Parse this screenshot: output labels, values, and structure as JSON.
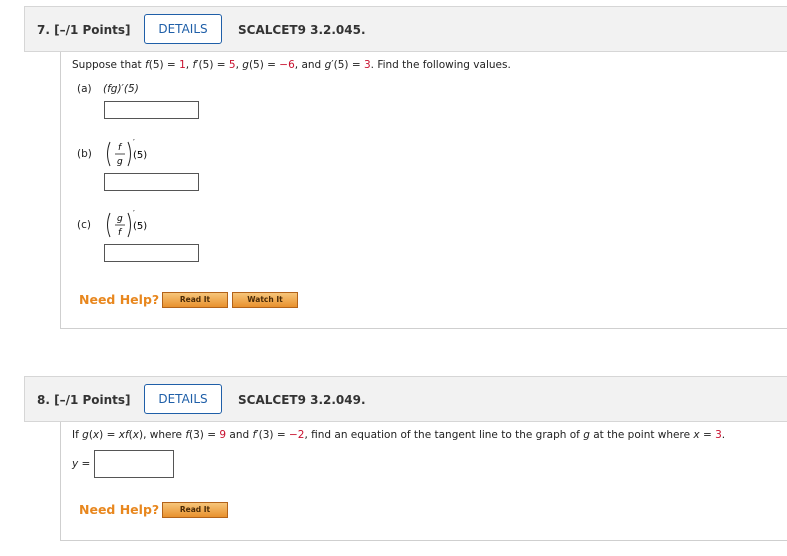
{
  "questions": [
    {
      "number": "7. [–/1 Points]",
      "details_label": "DETAILS",
      "code": "SCALCET9 3.2.045.",
      "prompt_parts": {
        "p1": "Suppose that ",
        "f": "f",
        "p2": "(5) = ",
        "v1": "1",
        "p3": ", ",
        "fp": "f",
        "p4": "′(5) = ",
        "v2": "5",
        "p5": ", ",
        "g": "g",
        "p6": "(5) = ",
        "v3": "−6",
        "p7": ", and ",
        "gp": "g",
        "p8": "′(5) = ",
        "v4": "3",
        "p9": ". Find the following values."
      },
      "parts": [
        {
          "label": "(a)",
          "expr": "(fg)′(5)"
        },
        {
          "label": "(b)",
          "num": "f",
          "den": "g",
          "suffix": "(5)"
        },
        {
          "label": "(c)",
          "num": "g",
          "den": "f",
          "suffix": "(5)"
        }
      ],
      "need_help": "Need Help?",
      "buttons": [
        "Read It",
        "Watch It"
      ]
    },
    {
      "number": "8. [–/1 Points]",
      "details_label": "DETAILS",
      "code": "SCALCET9 3.2.049.",
      "prompt_parts": {
        "p1": "If ",
        "g": "g",
        "p2": "(",
        "x1": "x",
        "p3": ") = ",
        "x2": "x",
        "f": "f",
        "p4": "(",
        "x3": "x",
        "p5": "), where ",
        "f2": "f",
        "p6": "(3) = ",
        "v1": "9",
        "p7": " and ",
        "f3": "f",
        "p8": "′(3) = ",
        "v2": "−2",
        "p9": ", find an equation of the tangent line to the graph of ",
        "g2": "g",
        "p10": " at the point where ",
        "x4": "x",
        "p11": " = ",
        "v3": "3",
        "p12": "."
      },
      "answer_label": "y =",
      "need_help": "Need Help?",
      "buttons": [
        "Read It"
      ]
    }
  ]
}
